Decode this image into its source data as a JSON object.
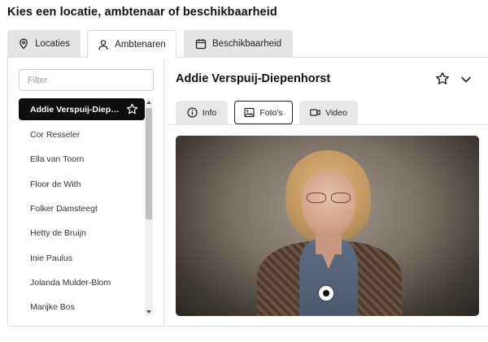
{
  "page": {
    "heading": "Kies een locatie, ambtenaar of beschikbaarheid"
  },
  "main_tabs": [
    {
      "label": "Locaties",
      "icon": "map-pin-icon",
      "active": false
    },
    {
      "label": "Ambtenaren",
      "icon": "user-icon",
      "active": true
    },
    {
      "label": "Beschikbaarheid",
      "icon": "calendar-icon",
      "active": false
    }
  ],
  "sidebar": {
    "filter": {
      "placeholder": "Filter",
      "value": ""
    },
    "items": [
      {
        "label": "Addie Verspuij-Diepenhorst",
        "selected": true
      },
      {
        "label": "Cor Resseler",
        "selected": false
      },
      {
        "label": "Ella van Toorn",
        "selected": false
      },
      {
        "label": "Floor de With",
        "selected": false
      },
      {
        "label": "Folker Damsteegt",
        "selected": false
      },
      {
        "label": "Hetty de Bruijn",
        "selected": false
      },
      {
        "label": "Inie Paulus",
        "selected": false
      },
      {
        "label": "Jolanda Mulder-Blom",
        "selected": false
      },
      {
        "label": "Marijke Bos",
        "selected": false
      }
    ]
  },
  "detail": {
    "title": "Addie Verspuij-Diepenhorst",
    "media_tabs": [
      {
        "label": "Info",
        "icon": "info-icon",
        "active": false
      },
      {
        "label": "Foto's",
        "icon": "image-icon",
        "active": true
      },
      {
        "label": "Video",
        "icon": "video-icon",
        "active": false
      }
    ]
  },
  "colors": {
    "selected_bg": "#0d0d0d",
    "tab_inactive_bg": "#e5e5e5",
    "border": "#dcdcdc"
  }
}
